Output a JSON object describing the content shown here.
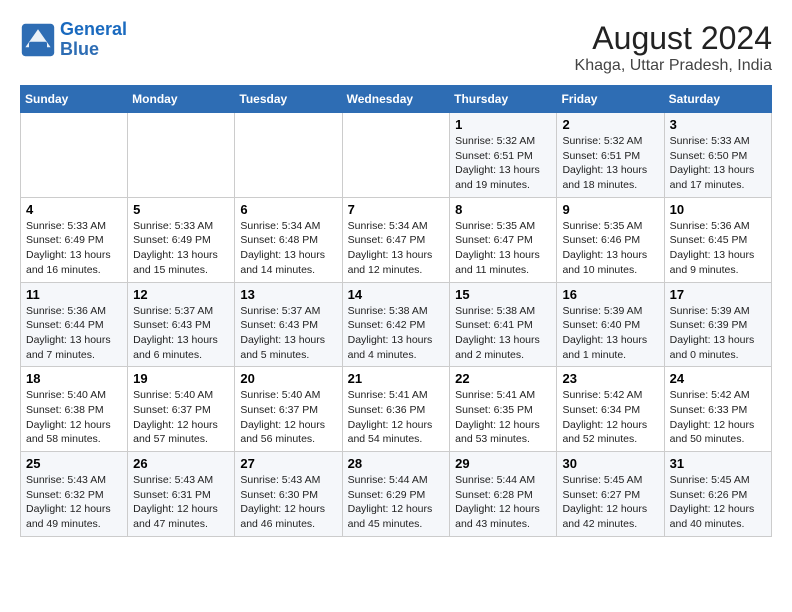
{
  "logo": {
    "line1": "General",
    "line2": "Blue"
  },
  "title": "August 2024",
  "subtitle": "Khaga, Uttar Pradesh, India",
  "days_of_week": [
    "Sunday",
    "Monday",
    "Tuesday",
    "Wednesday",
    "Thursday",
    "Friday",
    "Saturday"
  ],
  "weeks": [
    [
      {
        "num": "",
        "info": ""
      },
      {
        "num": "",
        "info": ""
      },
      {
        "num": "",
        "info": ""
      },
      {
        "num": "",
        "info": ""
      },
      {
        "num": "1",
        "info": "Sunrise: 5:32 AM\nSunset: 6:51 PM\nDaylight: 13 hours\nand 19 minutes."
      },
      {
        "num": "2",
        "info": "Sunrise: 5:32 AM\nSunset: 6:51 PM\nDaylight: 13 hours\nand 18 minutes."
      },
      {
        "num": "3",
        "info": "Sunrise: 5:33 AM\nSunset: 6:50 PM\nDaylight: 13 hours\nand 17 minutes."
      }
    ],
    [
      {
        "num": "4",
        "info": "Sunrise: 5:33 AM\nSunset: 6:49 PM\nDaylight: 13 hours\nand 16 minutes."
      },
      {
        "num": "5",
        "info": "Sunrise: 5:33 AM\nSunset: 6:49 PM\nDaylight: 13 hours\nand 15 minutes."
      },
      {
        "num": "6",
        "info": "Sunrise: 5:34 AM\nSunset: 6:48 PM\nDaylight: 13 hours\nand 14 minutes."
      },
      {
        "num": "7",
        "info": "Sunrise: 5:34 AM\nSunset: 6:47 PM\nDaylight: 13 hours\nand 12 minutes."
      },
      {
        "num": "8",
        "info": "Sunrise: 5:35 AM\nSunset: 6:47 PM\nDaylight: 13 hours\nand 11 minutes."
      },
      {
        "num": "9",
        "info": "Sunrise: 5:35 AM\nSunset: 6:46 PM\nDaylight: 13 hours\nand 10 minutes."
      },
      {
        "num": "10",
        "info": "Sunrise: 5:36 AM\nSunset: 6:45 PM\nDaylight: 13 hours\nand 9 minutes."
      }
    ],
    [
      {
        "num": "11",
        "info": "Sunrise: 5:36 AM\nSunset: 6:44 PM\nDaylight: 13 hours\nand 7 minutes."
      },
      {
        "num": "12",
        "info": "Sunrise: 5:37 AM\nSunset: 6:43 PM\nDaylight: 13 hours\nand 6 minutes."
      },
      {
        "num": "13",
        "info": "Sunrise: 5:37 AM\nSunset: 6:43 PM\nDaylight: 13 hours\nand 5 minutes."
      },
      {
        "num": "14",
        "info": "Sunrise: 5:38 AM\nSunset: 6:42 PM\nDaylight: 13 hours\nand 4 minutes."
      },
      {
        "num": "15",
        "info": "Sunrise: 5:38 AM\nSunset: 6:41 PM\nDaylight: 13 hours\nand 2 minutes."
      },
      {
        "num": "16",
        "info": "Sunrise: 5:39 AM\nSunset: 6:40 PM\nDaylight: 13 hours\nand 1 minute."
      },
      {
        "num": "17",
        "info": "Sunrise: 5:39 AM\nSunset: 6:39 PM\nDaylight: 13 hours\nand 0 minutes."
      }
    ],
    [
      {
        "num": "18",
        "info": "Sunrise: 5:40 AM\nSunset: 6:38 PM\nDaylight: 12 hours\nand 58 minutes."
      },
      {
        "num": "19",
        "info": "Sunrise: 5:40 AM\nSunset: 6:37 PM\nDaylight: 12 hours\nand 57 minutes."
      },
      {
        "num": "20",
        "info": "Sunrise: 5:40 AM\nSunset: 6:37 PM\nDaylight: 12 hours\nand 56 minutes."
      },
      {
        "num": "21",
        "info": "Sunrise: 5:41 AM\nSunset: 6:36 PM\nDaylight: 12 hours\nand 54 minutes."
      },
      {
        "num": "22",
        "info": "Sunrise: 5:41 AM\nSunset: 6:35 PM\nDaylight: 12 hours\nand 53 minutes."
      },
      {
        "num": "23",
        "info": "Sunrise: 5:42 AM\nSunset: 6:34 PM\nDaylight: 12 hours\nand 52 minutes."
      },
      {
        "num": "24",
        "info": "Sunrise: 5:42 AM\nSunset: 6:33 PM\nDaylight: 12 hours\nand 50 minutes."
      }
    ],
    [
      {
        "num": "25",
        "info": "Sunrise: 5:43 AM\nSunset: 6:32 PM\nDaylight: 12 hours\nand 49 minutes."
      },
      {
        "num": "26",
        "info": "Sunrise: 5:43 AM\nSunset: 6:31 PM\nDaylight: 12 hours\nand 47 minutes."
      },
      {
        "num": "27",
        "info": "Sunrise: 5:43 AM\nSunset: 6:30 PM\nDaylight: 12 hours\nand 46 minutes."
      },
      {
        "num": "28",
        "info": "Sunrise: 5:44 AM\nSunset: 6:29 PM\nDaylight: 12 hours\nand 45 minutes."
      },
      {
        "num": "29",
        "info": "Sunrise: 5:44 AM\nSunset: 6:28 PM\nDaylight: 12 hours\nand 43 minutes."
      },
      {
        "num": "30",
        "info": "Sunrise: 5:45 AM\nSunset: 6:27 PM\nDaylight: 12 hours\nand 42 minutes."
      },
      {
        "num": "31",
        "info": "Sunrise: 5:45 AM\nSunset: 6:26 PM\nDaylight: 12 hours\nand 40 minutes."
      }
    ]
  ]
}
